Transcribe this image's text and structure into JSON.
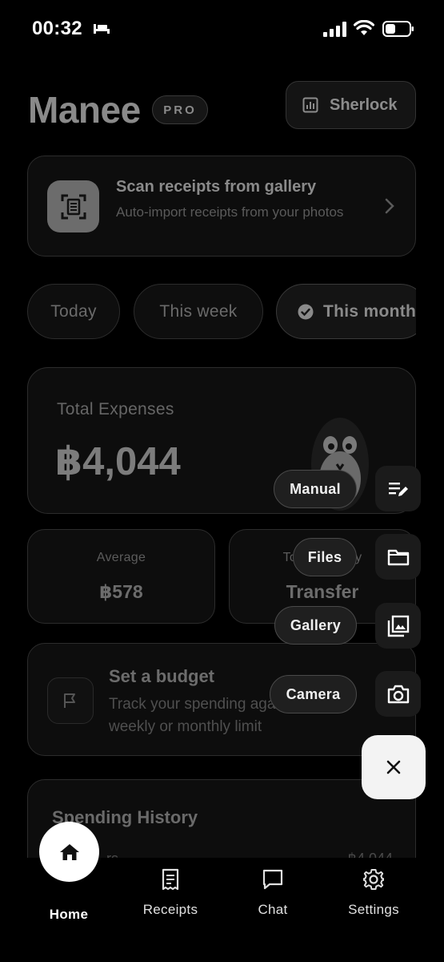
{
  "status_bar": {
    "time": "00:32"
  },
  "header": {
    "app_name": "Manee",
    "badge": "PRO",
    "sherlock_label": "Sherlock"
  },
  "scan_card": {
    "title": "Scan receipts from gallery",
    "subtitle": "Auto-import receipts from your photos"
  },
  "period_chips": [
    {
      "label": "Today",
      "selected": false
    },
    {
      "label": "This week",
      "selected": false
    },
    {
      "label": "This month",
      "selected": true
    }
  ],
  "total_expenses": {
    "label": "Total Expenses",
    "value": "฿4,044"
  },
  "stats": {
    "average": {
      "label": "Average",
      "value": "฿578"
    },
    "top_category": {
      "label": "Top Category",
      "value": "Transfer"
    }
  },
  "budget": {
    "title": "Set a budget",
    "subtitle": "Track your spending against a weekly or monthly limit"
  },
  "history": {
    "title": "Spending History",
    "row_left": "…rs",
    "row_right": "฿4,044"
  },
  "fab_menu": {
    "items": [
      {
        "label": "Manual",
        "icon": "edit-note-icon"
      },
      {
        "label": "Files",
        "icon": "folder-icon"
      },
      {
        "label": "Gallery",
        "icon": "gallery-icon"
      },
      {
        "label": "Camera",
        "icon": "camera-icon"
      }
    ],
    "close_icon": "close-icon"
  },
  "bottom_nav": [
    {
      "label": "Home",
      "icon": "home-icon",
      "active": true
    },
    {
      "label": "Receipts",
      "icon": "receipt-icon",
      "active": false
    },
    {
      "label": "Chat",
      "icon": "chat-icon",
      "active": false
    },
    {
      "label": "Settings",
      "icon": "gear-icon",
      "active": false
    }
  ],
  "colors": {
    "background": "#000000",
    "fab_close_bg": "#f3f3f3"
  }
}
